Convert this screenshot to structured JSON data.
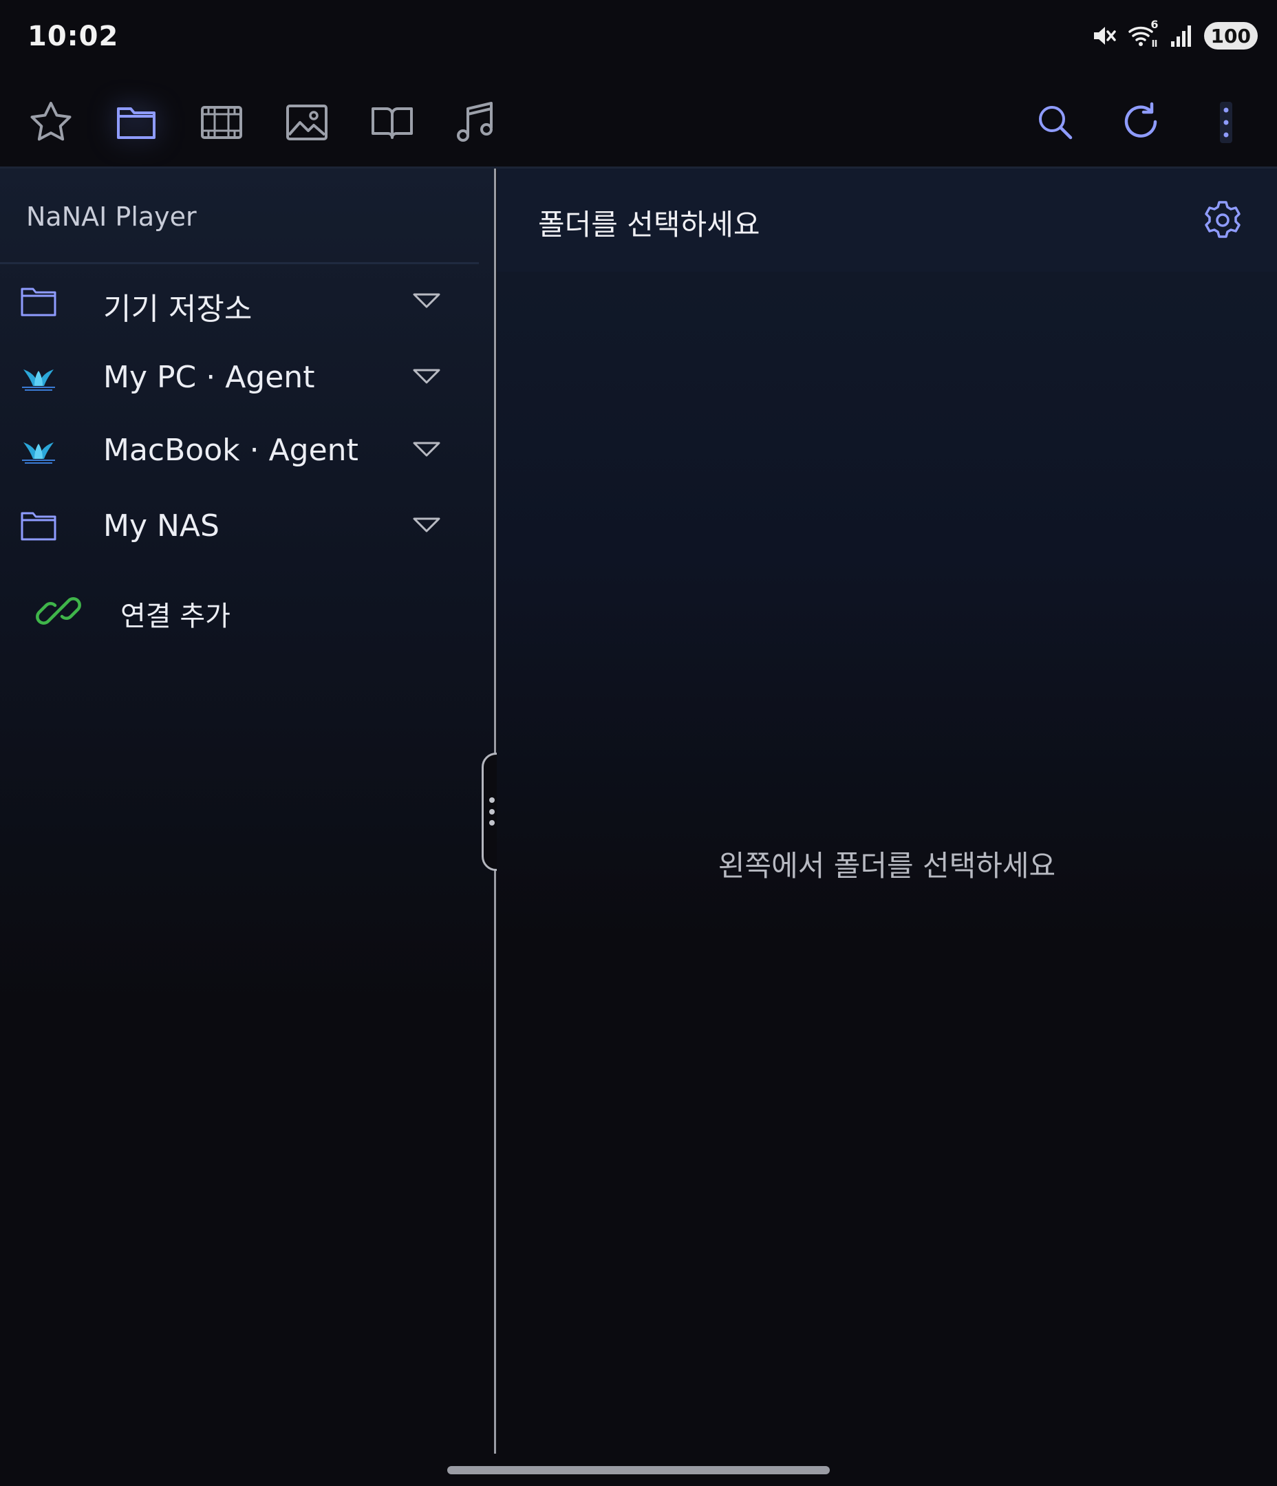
{
  "status_bar": {
    "time": "10:02",
    "icons": [
      "mute-icon",
      "wifi-icon",
      "signal-icon"
    ],
    "wifi_badge": "6",
    "battery": "100"
  },
  "toolbar": {
    "tabs": [
      {
        "name": "favorites",
        "icon": "star-icon",
        "active": false
      },
      {
        "name": "folders",
        "icon": "folder-icon",
        "active": true
      },
      {
        "name": "videos",
        "icon": "film-icon",
        "active": false
      },
      {
        "name": "photos",
        "icon": "image-icon",
        "active": false
      },
      {
        "name": "books",
        "icon": "book-icon",
        "active": false
      },
      {
        "name": "music",
        "icon": "music-icon",
        "active": false
      }
    ],
    "actions": [
      "search-icon",
      "refresh-icon",
      "more-vertical-icon"
    ]
  },
  "sidebar": {
    "title": "NaNAI Player",
    "items": [
      {
        "label": "기기 저장소",
        "icon": "folder-icon"
      },
      {
        "label": "My PC · Agent",
        "icon": "agent-icon"
      },
      {
        "label": "MacBook · Agent",
        "icon": "agent-icon"
      },
      {
        "label": "My NAS",
        "icon": "folder-icon"
      }
    ],
    "add_connection": {
      "label": "연결 추가",
      "icon": "link-icon"
    }
  },
  "main": {
    "title": "폴더를 선택하세요",
    "empty_message": "왼쪽에서 폴더를 선택하세요"
  },
  "colors": {
    "accent": "#8f9cff",
    "icon_gray": "#9ca0aa",
    "link_green": "#3fb54a",
    "background": "#0b0b10"
  }
}
